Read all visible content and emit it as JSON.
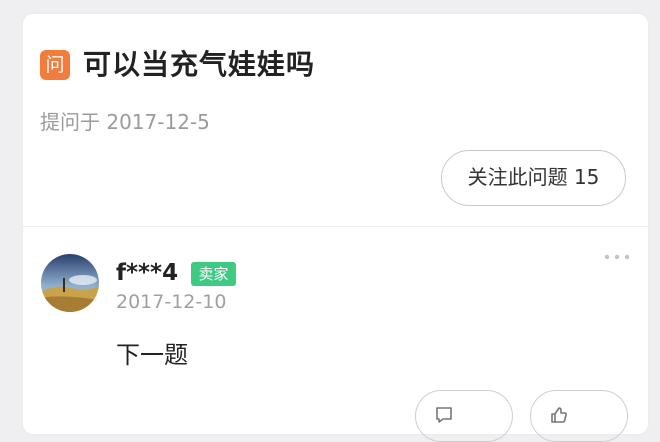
{
  "question": {
    "badge": "问",
    "title": "可以当充气娃娃吗",
    "asked_label": "提问于 2017-12-5",
    "follow_button": "关注此问题 15"
  },
  "answer": {
    "user_name": "f***4",
    "seller_badge": "卖家",
    "date": "2017-12-10",
    "text": "下一题"
  },
  "icons": {
    "avatar": "avatar",
    "more": "more-icon",
    "comment": "comment-icon",
    "like": "like-icon"
  },
  "colors": {
    "badge_orange": "#f37b3c",
    "seller_green": "#3fca84",
    "page_bg": "#efeff1"
  }
}
